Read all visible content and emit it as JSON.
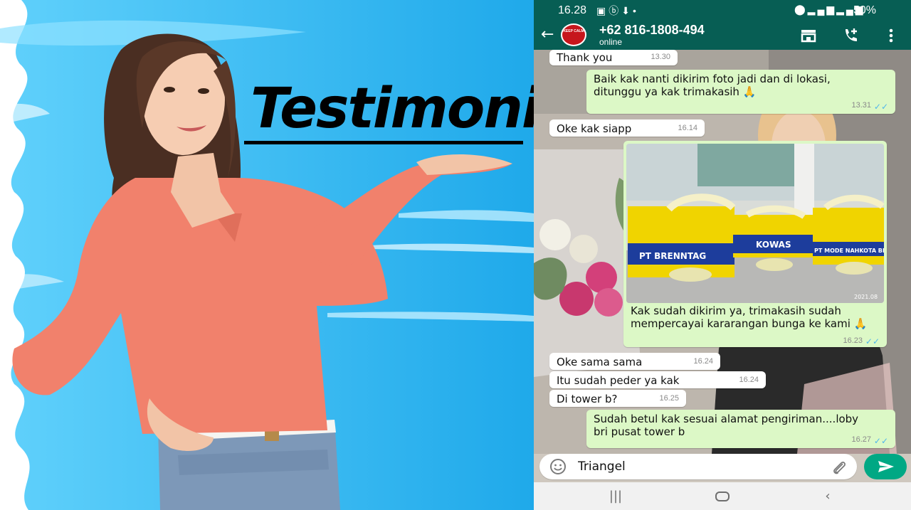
{
  "promo": {
    "title": "Testimoni"
  },
  "status_bar": {
    "time": "16.28",
    "battery": "50%"
  },
  "app_bar": {
    "contact_name": "+62 816-1808-494",
    "contact_status": "online",
    "avatar_text": "KEEP CALM"
  },
  "messages": [
    {
      "direction": "in",
      "text": "Thank you",
      "time": "13.30"
    },
    {
      "direction": "out",
      "text": "Baik kak nanti dikirim foto jadi dan di lokasi, ditunggu ya kak trimakasih 🙏",
      "time": "13.31"
    },
    {
      "direction": "in",
      "text": "Oke kak siapp",
      "time": "16.14"
    },
    {
      "direction": "out",
      "text": "Kak sudah dikirim ya, trimakasih sudah mempercayai kararangan bunga ke kami 🙏",
      "time": "16.23"
    },
    {
      "direction": "in",
      "text": "Oke sama sama",
      "time": "16.24"
    },
    {
      "direction": "in",
      "text": "Itu sudah peder ya kak",
      "time": "16.24"
    },
    {
      "direction": "in",
      "text": "Di tower b?",
      "time": "16.25"
    },
    {
      "direction": "out",
      "text": "Sudah betul kak sesuai alamat pengiriman....loby bri pusat tower b",
      "time": "16.27"
    }
  ],
  "photo": {
    "board_labels": [
      "PT BRENNTAG",
      "KOWAS",
      "PT MODE NAHKOTA BISNI"
    ],
    "stamp": "2021.08"
  },
  "composer": {
    "input_value": "Triangel"
  },
  "colors": {
    "header": "#075e54",
    "outgoing_bubble": "#dcf8c6",
    "incoming_bubble": "#ffffff",
    "send_button": "#00a884",
    "read_ticks": "#4fb6ec",
    "promo_blue": "#27b2ef"
  }
}
